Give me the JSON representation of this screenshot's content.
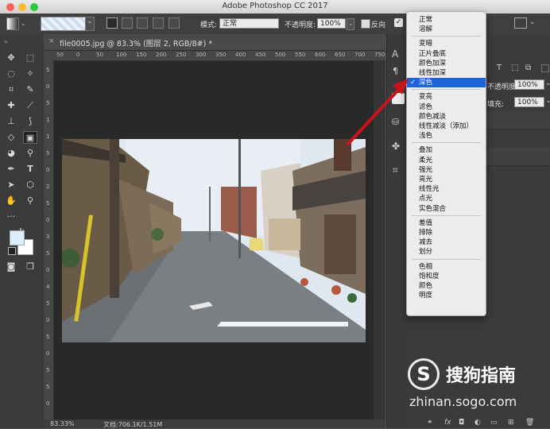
{
  "window": {
    "title": "Adobe Photoshop CC 2017"
  },
  "options": {
    "mode_label": "模式:",
    "mode_value": "正常",
    "opacity_label": "不透明度:",
    "opacity_value": "100%",
    "reverse_label": "反向"
  },
  "document": {
    "tab_title": "file0005.jpg @ 83.3% (图层 2, RGB/8#) *",
    "zoom": "83.33%",
    "doc_size": "文档:706.1K/1.51M"
  },
  "ruler": {
    "top_labels": [
      "50",
      "0",
      "50",
      "100",
      "150",
      "200",
      "250",
      "300",
      "350",
      "400",
      "450",
      "500",
      "550",
      "600",
      "650",
      "700",
      "750"
    ],
    "left_labels": [
      "5",
      "0",
      "5",
      "1",
      "1",
      "5",
      "0",
      "2",
      "5",
      "0",
      "3",
      "5",
      "0",
      "4",
      "5",
      "0",
      "5",
      "0",
      "5",
      "5",
      "0"
    ]
  },
  "layers_panel": {
    "opacity_label": "不透明度:",
    "opacity_value": "100%",
    "fill_label": "填充:",
    "fill_value": "100%"
  },
  "blend_modes": {
    "selected": "深色",
    "groups": [
      [
        "正常",
        "溶解"
      ],
      [
        "变暗",
        "正片叠底",
        "颜色加深",
        "线性加深",
        "深色"
      ],
      [
        "变亮",
        "滤色",
        "颜色减淡",
        "线性减淡（添加）",
        "浅色"
      ],
      [
        "叠加",
        "柔光",
        "强光",
        "亮光",
        "线性光",
        "点光",
        "实色混合"
      ],
      [
        "差值",
        "排除",
        "减去",
        "划分"
      ],
      [
        "色相",
        "饱和度",
        "颜色",
        "明度"
      ]
    ]
  },
  "watermark": {
    "brand": "搜狗指南",
    "url": "zhinan.sogo.com"
  },
  "colors": {
    "selection": "#1e64d8",
    "arrow": "#c8141b"
  }
}
